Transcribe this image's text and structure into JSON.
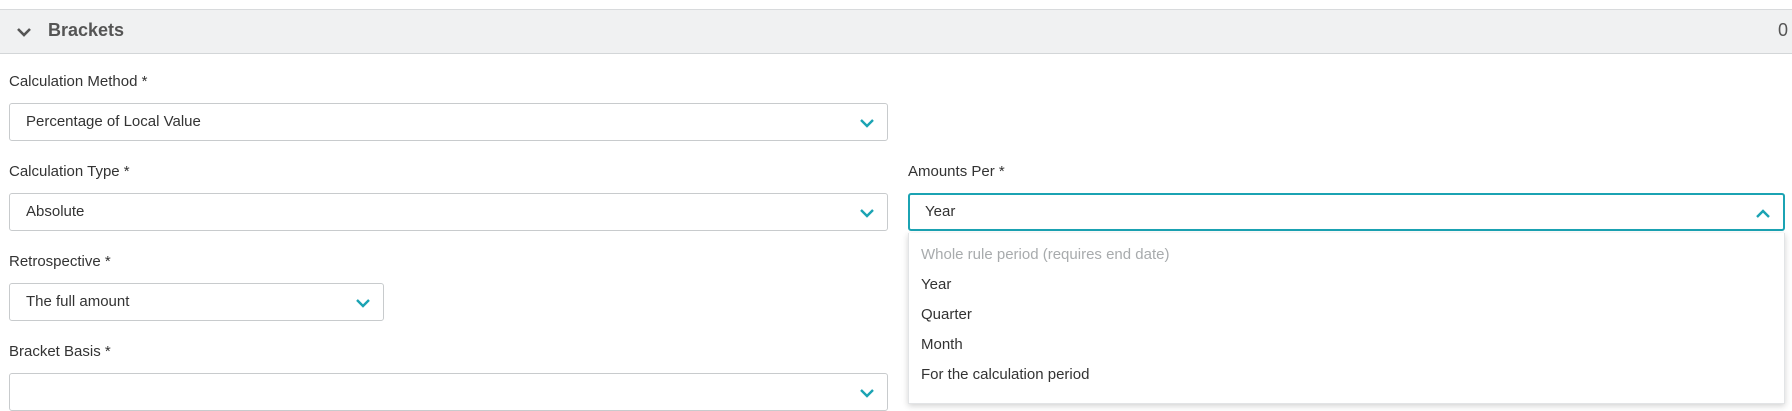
{
  "section": {
    "title": "Brackets",
    "count": "0",
    "icon": "chevron-down-icon"
  },
  "fields": {
    "calculation_method": {
      "label": "Calculation Method *",
      "value": "Percentage of Local Value"
    },
    "calculation_type": {
      "label": "Calculation Type *",
      "value": "Absolute"
    },
    "amounts_per": {
      "label": "Amounts Per *",
      "value": "Year"
    },
    "retrospective": {
      "label": "Retrospective *",
      "value": "The full amount"
    },
    "bracket_basis": {
      "label": "Bracket Basis *",
      "value": ""
    }
  },
  "dropdown": {
    "options": [
      {
        "label": "Whole rule period (requires end date)",
        "disabled": true
      },
      {
        "label": "Year"
      },
      {
        "label": "Quarter"
      },
      {
        "label": "Month"
      },
      {
        "label": "For the calculation period"
      }
    ]
  },
  "colors": {
    "accent": "#1ba3b3",
    "header_bg": "#f0f1f2"
  }
}
